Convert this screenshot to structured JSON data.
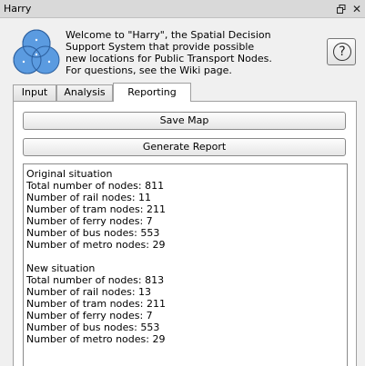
{
  "window": {
    "title": "Harry",
    "float_icon": "float-window-icon",
    "close_glyph": "✕"
  },
  "logo": {
    "icon": "venn-diagram-logo-icon",
    "colors": [
      "#4a90d9",
      "#6aa8e6"
    ]
  },
  "intro": {
    "lines": [
      "Welcome to \"Harry\", the Spatial Decision",
      "Support System that provide possible",
      "new locations for Public Transport Nodes.",
      "For questions, see the Wiki page."
    ]
  },
  "help_button": {
    "glyph": "?"
  },
  "tabs": [
    {
      "label": "Input",
      "selected": false
    },
    {
      "label": "Analysis",
      "selected": false
    },
    {
      "label": "Reporting",
      "selected": true
    }
  ],
  "reporting": {
    "save_map_label": "Save Map",
    "generate_report_label": "Generate Report",
    "report": {
      "original": {
        "heading": "Original situation",
        "lines": [
          "Total number of nodes: 811",
          "Number of rail nodes: 11",
          "Number of tram nodes: 211",
          "Number of ferry nodes: 7",
          "Number of bus nodes: 553",
          "Number of metro nodes: 29"
        ]
      },
      "new": {
        "heading": "New situation",
        "lines": [
          "Total number of nodes: 813",
          "Number of rail nodes: 13",
          "Number of tram nodes: 211",
          "Number of ferry nodes: 7",
          "Number of bus nodes: 553",
          "Number of metro nodes: 29"
        ]
      }
    }
  }
}
